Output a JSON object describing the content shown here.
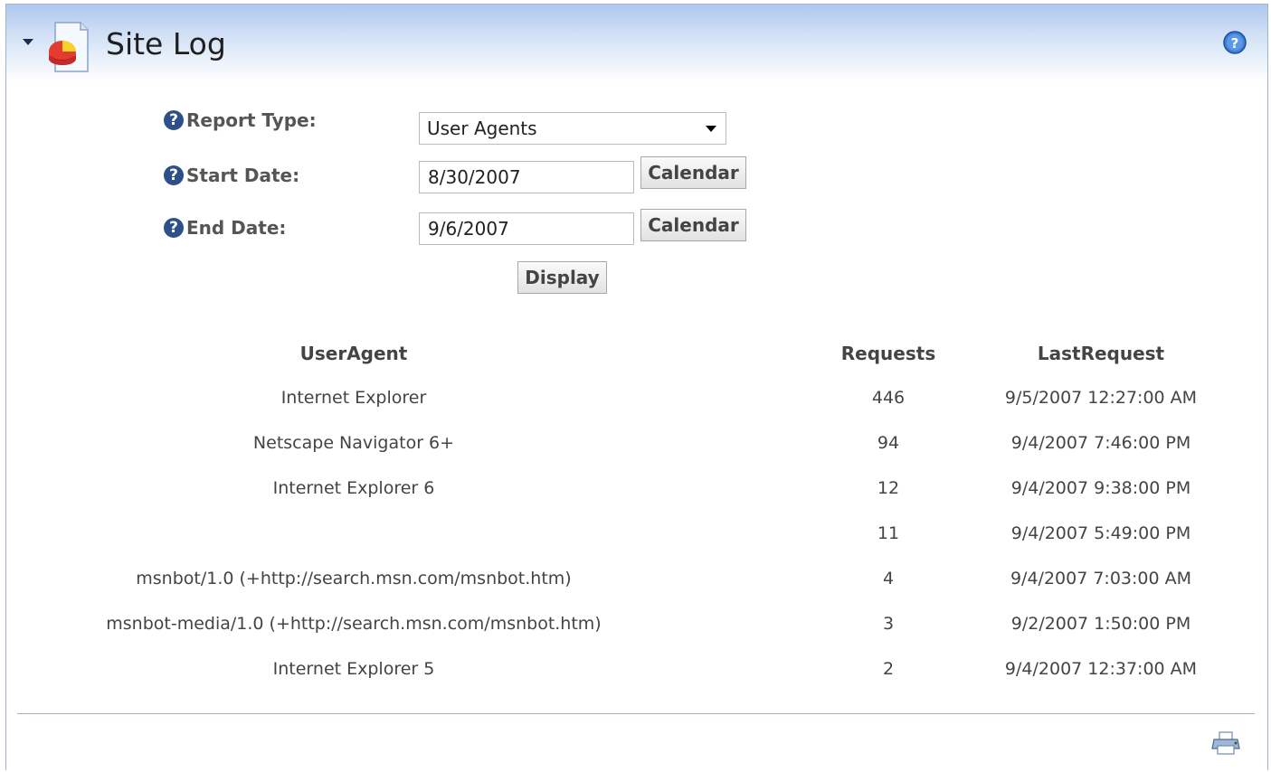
{
  "header": {
    "title": "Site Log"
  },
  "form": {
    "report_type_label": "Report Type:",
    "report_type_value": "User Agents",
    "start_date_label": "Start Date:",
    "start_date_value": "8/30/2007",
    "end_date_label": "End Date:",
    "end_date_value": "9/6/2007",
    "calendar_label": "Calendar",
    "display_label": "Display",
    "help_glyph": "?"
  },
  "table": {
    "columns": [
      "UserAgent",
      "Requests",
      "LastRequest"
    ],
    "rows": [
      {
        "agent": "Internet Explorer",
        "requests": "446",
        "last": "9/5/2007 12:27:00 AM"
      },
      {
        "agent": "Netscape Navigator 6+",
        "requests": "94",
        "last": "9/4/2007 7:46:00 PM"
      },
      {
        "agent": "Internet Explorer 6",
        "requests": "12",
        "last": "9/4/2007 9:38:00 PM"
      },
      {
        "agent": "",
        "requests": "11",
        "last": "9/4/2007 5:49:00 PM"
      },
      {
        "agent": "msnbot/1.0 (+http://search.msn.com/msnbot.htm)",
        "requests": "4",
        "last": "9/4/2007 7:03:00 AM"
      },
      {
        "agent": "msnbot-media/1.0 (+http://search.msn.com/msnbot.htm)",
        "requests": "3",
        "last": "9/2/2007 1:50:00 PM"
      },
      {
        "agent": "Internet Explorer 5",
        "requests": "2",
        "last": "9/4/2007 12:37:00 AM"
      }
    ]
  },
  "icons": {
    "collapse": "chevron-down-icon",
    "module": "site-log-pie-chart-icon",
    "help": "help-icon",
    "print": "print-icon"
  },
  "colors": {
    "header_gradient_top": "#aec8ee",
    "border": "#9fb2c8",
    "help_blue": "#2d4f8a"
  }
}
